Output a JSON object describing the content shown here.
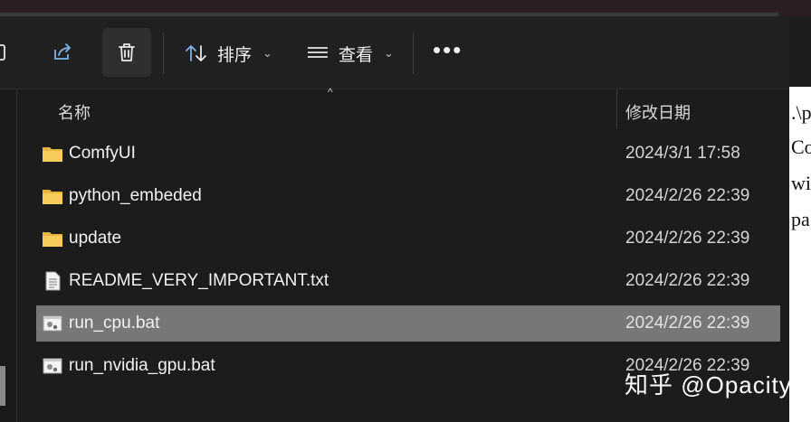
{
  "toolbar": {
    "sort_label": "排序",
    "view_label": "查看",
    "more_label": "•••"
  },
  "columns": {
    "name": "名称",
    "date_modified": "修改日期"
  },
  "files": [
    {
      "name": "ComfyUI",
      "modified": "2024/3/1 17:58",
      "type": "folder"
    },
    {
      "name": "python_embeded",
      "modified": "2024/2/26 22:39",
      "type": "folder"
    },
    {
      "name": "update",
      "modified": "2024/2/26 22:39",
      "type": "folder"
    },
    {
      "name": "README_VERY_IMPORTANT.txt",
      "modified": "2024/2/26 22:39",
      "type": "text"
    },
    {
      "name": "run_cpu.bat",
      "modified": "2024/2/26 22:39",
      "type": "batch",
      "selected": true
    },
    {
      "name": "run_nvidia_gpu.bat",
      "modified": "2024/2/26 22:39",
      "type": "batch"
    }
  ],
  "side_text": [
    ".\\p",
    "Co",
    "wi",
    "pa"
  ],
  "watermark": "知乎 @Opacity",
  "colors": {
    "selected_row": "#777777",
    "folder": "#f2c14e",
    "background": "#1c1c1c"
  }
}
